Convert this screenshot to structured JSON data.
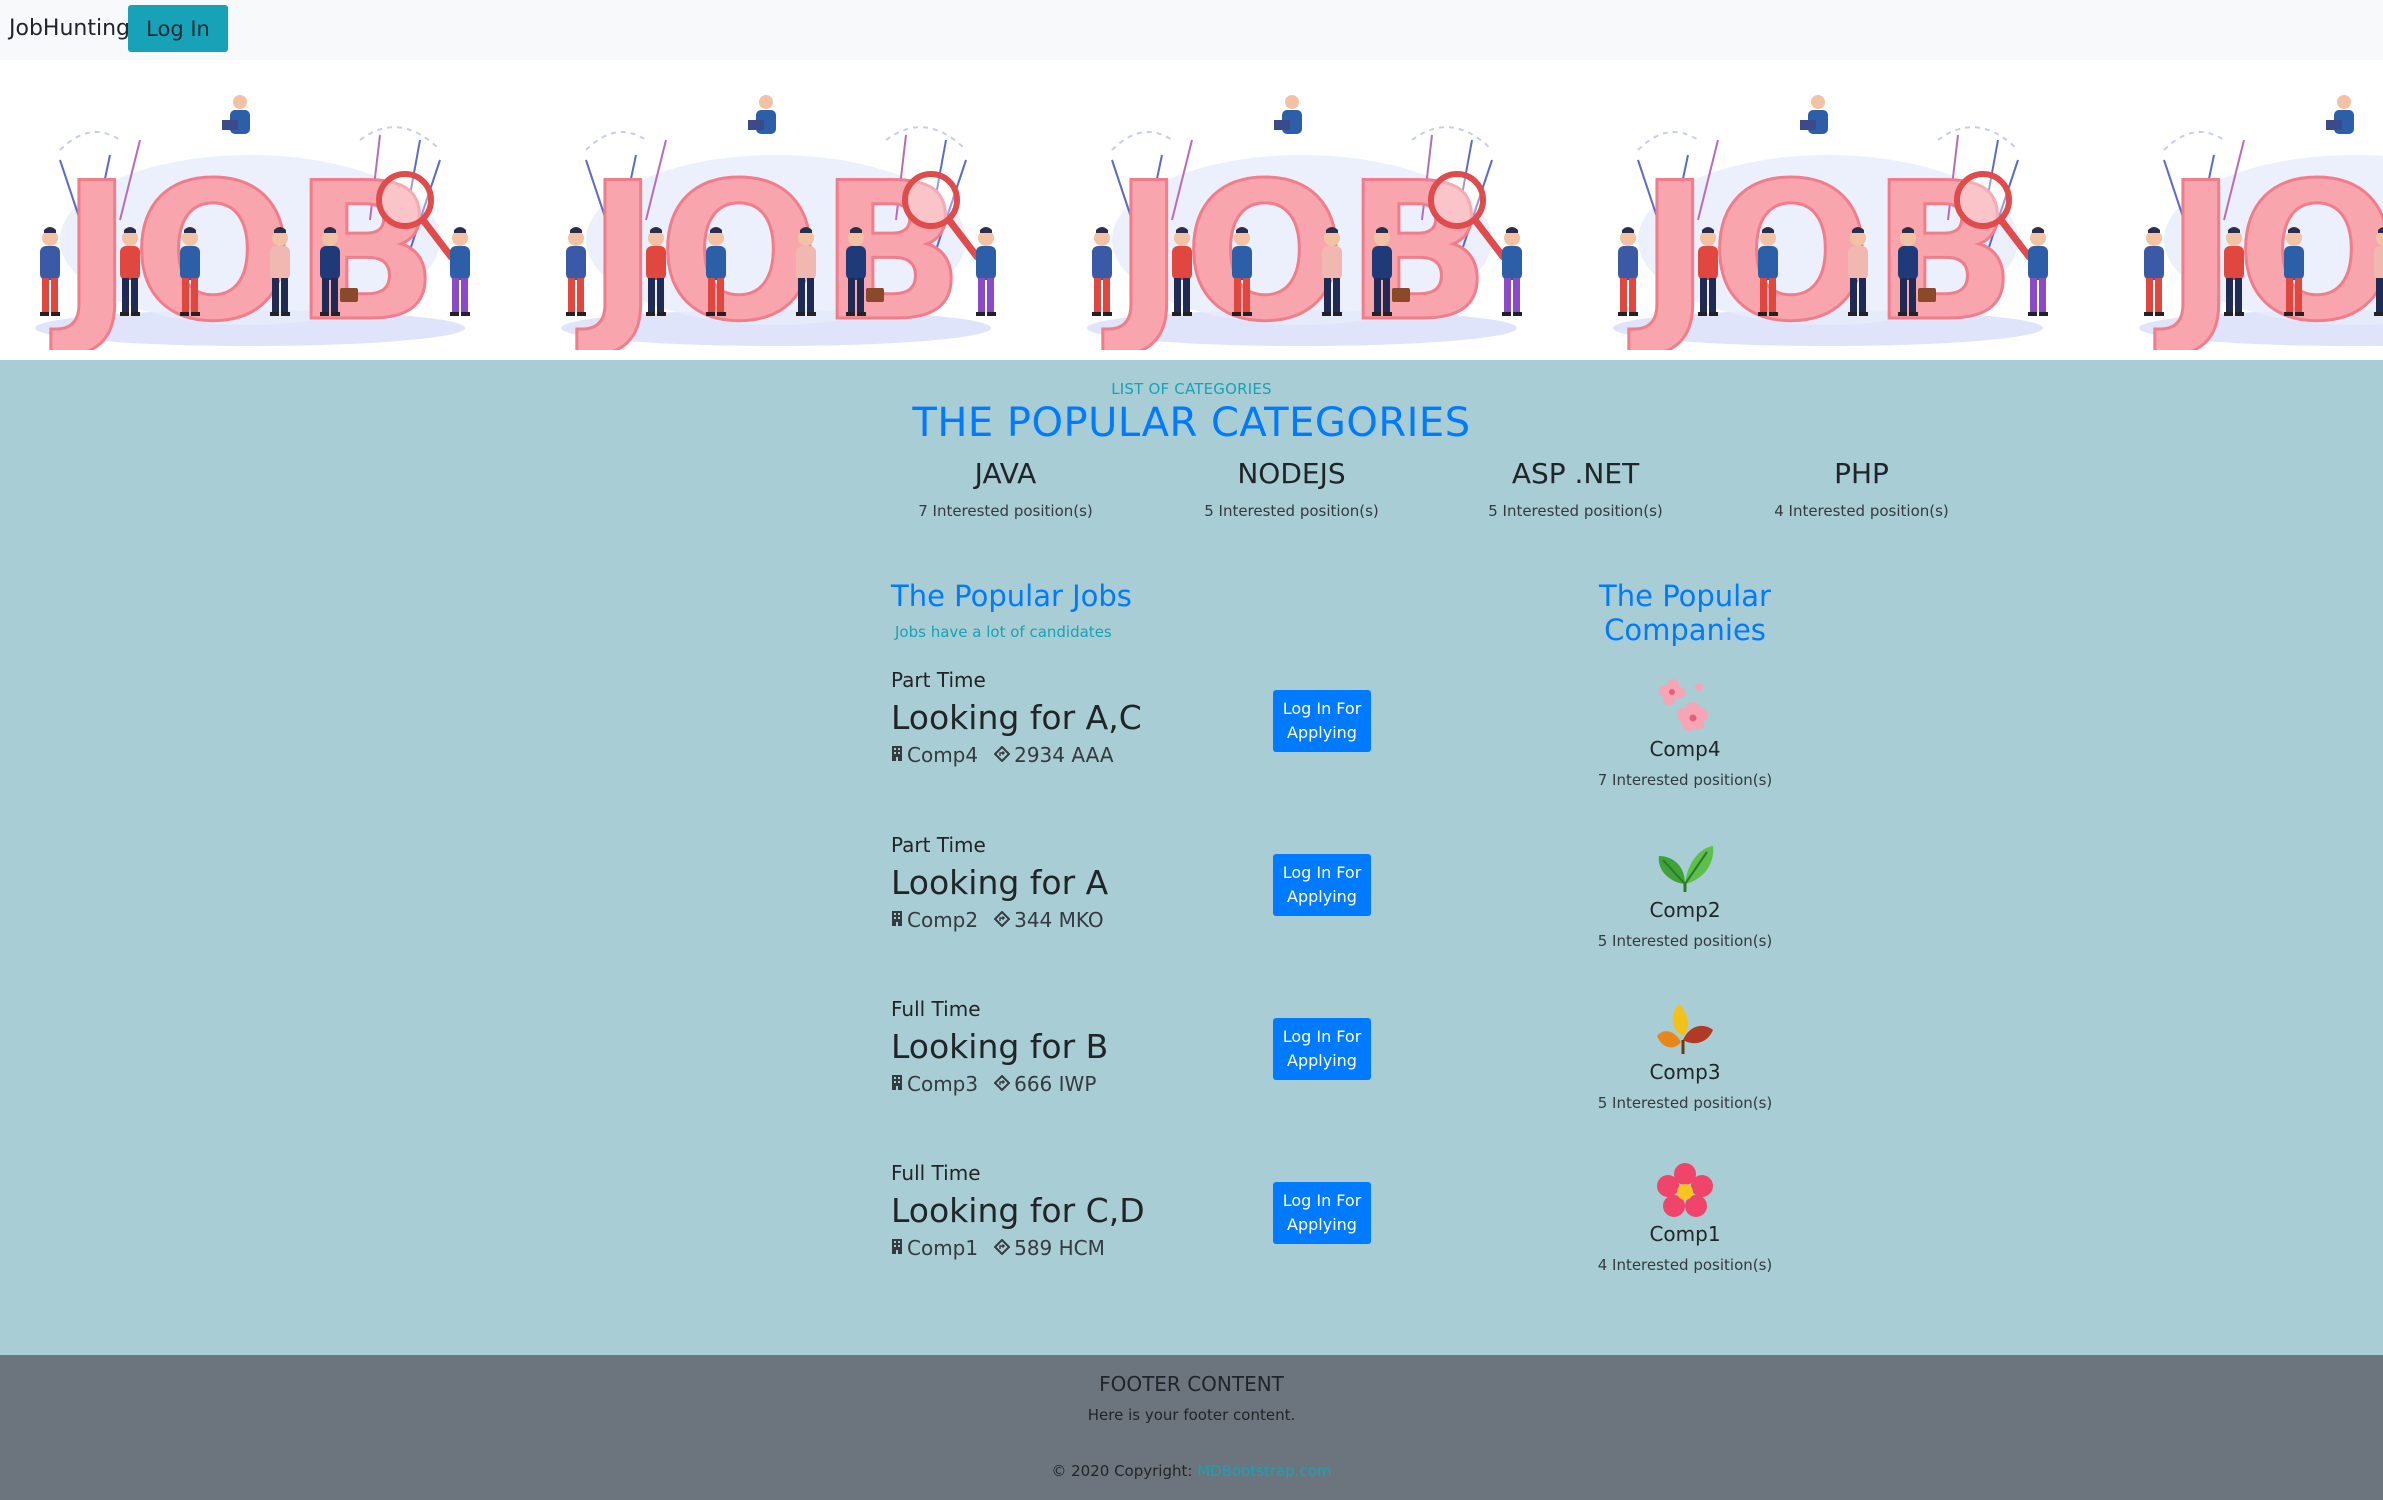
{
  "navbar": {
    "brand": "JobHunting",
    "login_label": "Log In"
  },
  "banner": {
    "image_text": "JOB",
    "accent_color": "#f8a5ad"
  },
  "categories": {
    "small_title": "LIST OF CATEGORIES",
    "title": "THE POPULAR CATEGORIES",
    "items": [
      {
        "name": "JAVA",
        "count": "7 Interested position(s)"
      },
      {
        "name": "NODEJS",
        "count": "5 Interested position(s)"
      },
      {
        "name": "ASP .NET",
        "count": "5 Interested position(s)"
      },
      {
        "name": "PHP",
        "count": "4 Interested position(s)"
      }
    ]
  },
  "jobs": {
    "title": "The Popular Jobs",
    "subtitle": "Jobs have a lot of candidates",
    "apply_label_line1": "Log In For",
    "apply_label_line2": "Applying",
    "items": [
      {
        "type": "Part Time",
        "title": "Looking for A,C",
        "company": "Comp4",
        "location": "2934 AAA"
      },
      {
        "type": "Part Time",
        "title": "Looking for A",
        "company": "Comp2",
        "location": "344 MKO"
      },
      {
        "type": "Full Time",
        "title": "Looking for B",
        "company": "Comp3",
        "location": "666 IWP"
      },
      {
        "type": "Full Time",
        "title": "Looking for C,D",
        "company": "Comp1",
        "location": "589 HCM"
      }
    ]
  },
  "companies": {
    "title": "The Popular Companies",
    "items": [
      {
        "name": "Comp4",
        "count": "7 Interested position(s)",
        "logo": "pink-blossom-icon"
      },
      {
        "name": "Comp2",
        "count": "5 Interested position(s)",
        "logo": "green-leaf-icon"
      },
      {
        "name": "Comp3",
        "count": "5 Interested position(s)",
        "logo": "autumn-leaves-icon"
      },
      {
        "name": "Comp1",
        "count": "4 Interested position(s)",
        "logo": "red-flower-icon"
      }
    ]
  },
  "footer": {
    "title": "FOOTER CONTENT",
    "text": "Here is your footer content.",
    "copyright": "© 2020 Copyright:",
    "link": "MDBootstrap.com"
  },
  "colors": {
    "primary": "#007bff",
    "info": "#17a2b8",
    "content_bg": "#a8cdd4",
    "footer_bg": "#6c757d"
  }
}
